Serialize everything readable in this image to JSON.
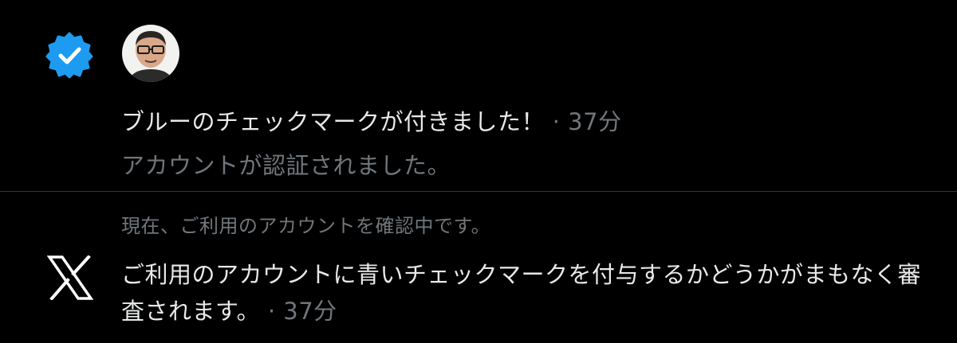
{
  "notifications": [
    {
      "icon": "verified-badge-icon",
      "icon_color": "#1d9bf0",
      "title": "ブルーのチェックマークが付きました！",
      "time": "37分",
      "subtitle": "アカウントが認証されました。"
    },
    {
      "icon": "x-logo-icon",
      "context": "現在、ご利用のアカウントを確認中です。",
      "body": "ご利用のアカウントに青いチェックマークを付与するかどうかがまもなく審査されます。",
      "time": "37分"
    }
  ],
  "separator": " · ",
  "colors": {
    "background": "#000000",
    "primary_text": "#e7e9ea",
    "secondary_text": "#71767b",
    "divider": "#2f3336",
    "accent": "#1d9bf0"
  }
}
